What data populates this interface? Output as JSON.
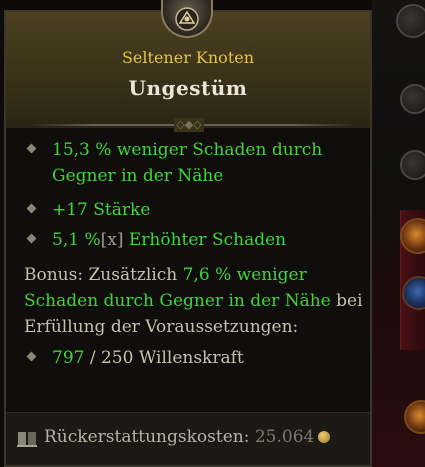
{
  "tooltip": {
    "rarity": "Seltener Knoten",
    "title": "Ungestüm",
    "emblem_icon": "paragon-node-icon",
    "colors": {
      "rarity": "#e4c441",
      "affix": "#42d43a",
      "header_bg": "#3a3219"
    }
  },
  "affixes": [
    {
      "value": "15,3 % weniger Schaden durch Gegner in der Nähe"
    },
    {
      "value": "+17 Stärke"
    },
    {
      "value": "5,1 %",
      "tag": "[x]",
      "rest": "Erhöhter Schaden"
    }
  ],
  "bonus": {
    "prefix": "Bonus: Zusätzlich",
    "green": "7,6 % weniger Schaden durch Gegner in der Nähe",
    "suffix": "bei Erfüllung der Voraussetzungen:"
  },
  "requirement": {
    "current": "797",
    "required": "/ 250 Willenskraft"
  },
  "footer": {
    "label": "Rückerstattungskosten:",
    "value": "25.064",
    "icon": "refund-icon",
    "currency_icon": "gold-coin-icon"
  }
}
